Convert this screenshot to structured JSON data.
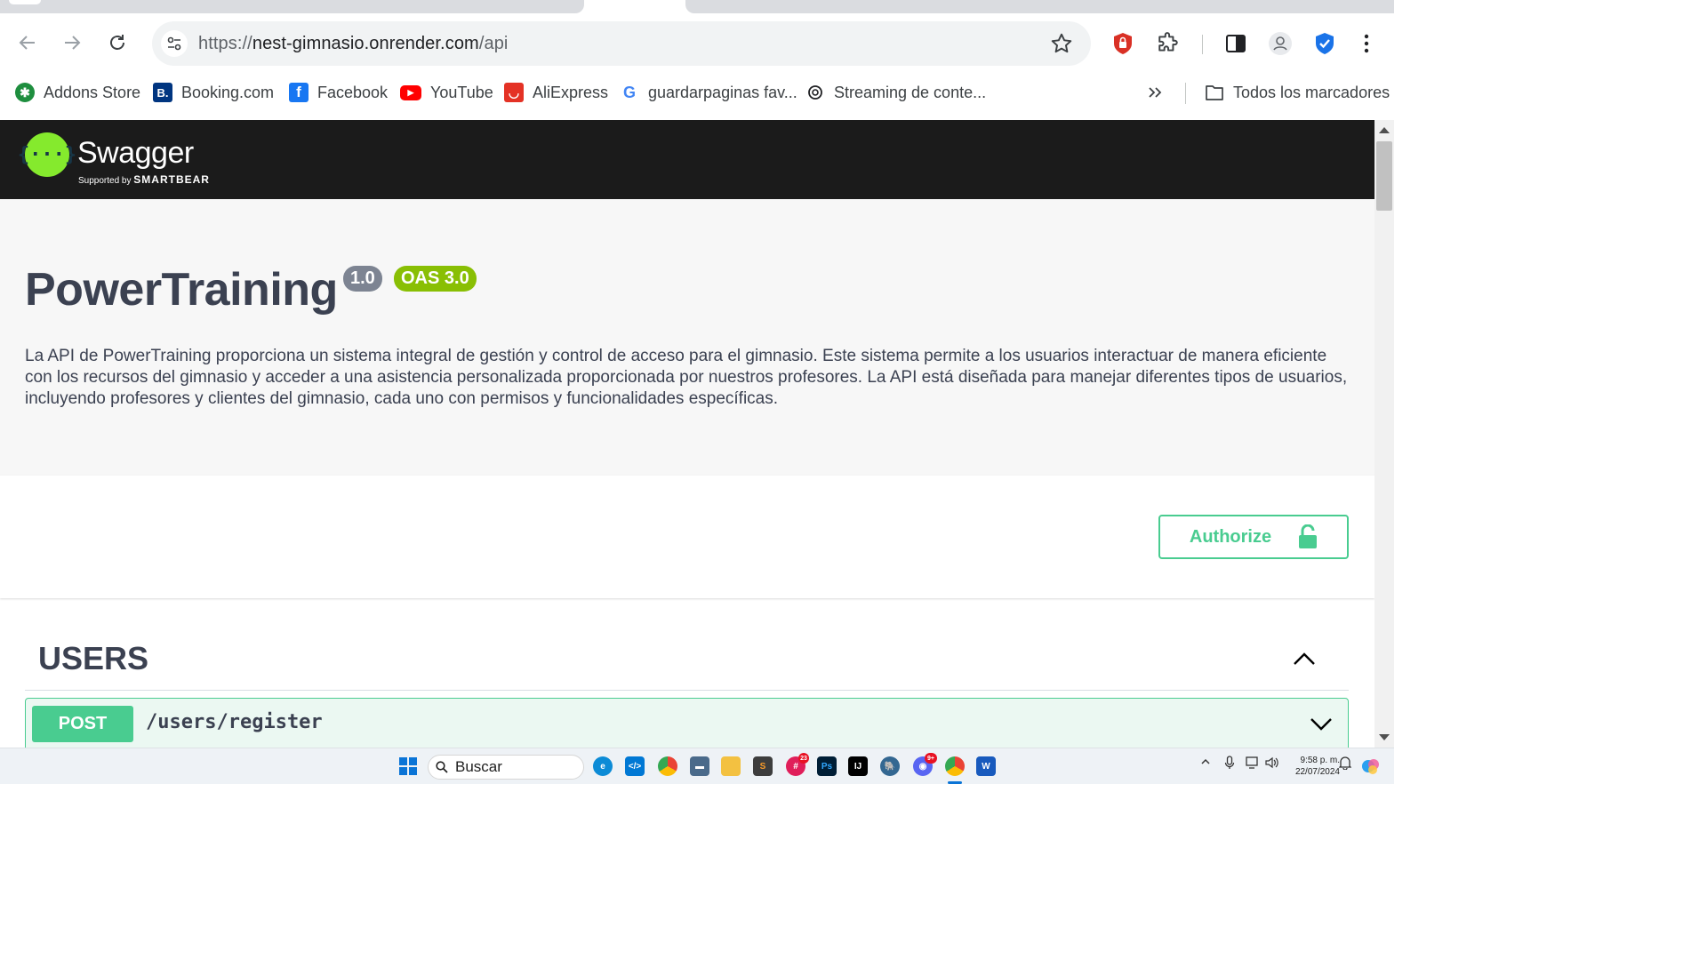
{
  "browser": {
    "url_prefix": "https://",
    "url_host": "nest-gimnasio.onrender.com",
    "url_path": "/api",
    "bookmarks": [
      {
        "label": "Addons Store",
        "icon": "addons-store-icon",
        "color": "#1e8e3e",
        "glyph": "✱"
      },
      {
        "label": "Booking.com",
        "icon": "booking-icon",
        "color": "#003580",
        "glyph": "B."
      },
      {
        "label": "Facebook",
        "icon": "facebook-icon",
        "color": "#1877f2",
        "glyph": "f"
      },
      {
        "label": "YouTube",
        "icon": "youtube-icon",
        "color": "#ff0000",
        "glyph": "▶"
      },
      {
        "label": "AliExpress",
        "icon": "aliexpress-icon",
        "color": "#e43225",
        "glyph": "◡"
      },
      {
        "label": "guardarpaginas fav...",
        "icon": "google-icon",
        "color": "#ffffff",
        "glyph": "G"
      },
      {
        "label": "Streaming de conte...",
        "icon": "openai-icon",
        "color": "#ffffff",
        "glyph": "⚙"
      }
    ],
    "all_bookmarks_label": "Todos los marcadores"
  },
  "swagger": {
    "brand": "Swagger",
    "supported_by": "Supported by",
    "company": "SMARTBEAR"
  },
  "info": {
    "title": "PowerTraining",
    "version": "1.0",
    "oas": "OAS 3.0",
    "description": "La API de PowerTraining proporciona un sistema integral de gestión y control de acceso para el gimnasio. Este sistema permite a los usuarios interactuar de manera eficiente con los recursos del gimnasio y acceder a una asistencia personalizada proporcionada por nuestros profesores. La API está diseñada para manejar diferentes tipos de usuarios, incluyendo profesores y clientes del gimnasio, cada uno con permisos y funcionalidades específicas."
  },
  "authorize_label": "Authorize",
  "sections": [
    {
      "title": "USERS",
      "operations": [
        {
          "method": "POST",
          "path": "/users/register"
        }
      ]
    }
  ],
  "taskbar": {
    "search_placeholder": "Buscar",
    "time": "9:58 p. m.",
    "date": "22/07/2024",
    "slack_badge": "23",
    "discord_badge": "9+"
  },
  "colors": {
    "swagger_green": "#85ea2d",
    "post_green": "#49cc90",
    "post_bg": "#ebf8f2",
    "oas_badge": "#89bf04",
    "version_badge": "#7d8492",
    "text_dark": "#3b4151"
  }
}
